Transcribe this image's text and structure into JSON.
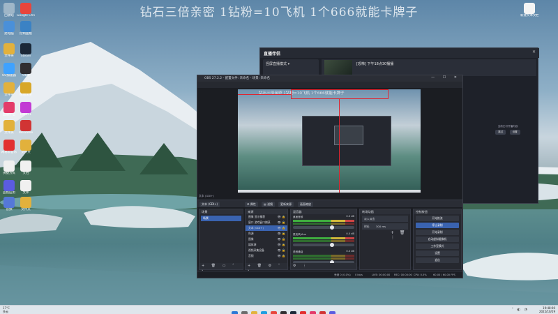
{
  "overlay_title": "钻石三倍亲密 1钻粉=10飞机  1个666就能卡牌子",
  "desktop_icons": [
    {
      "label": "回收站",
      "color": "#9fb6c8"
    },
    {
      "label": "Google Chrome",
      "color": "#e8453c"
    },
    {
      "label": "此电脑",
      "color": "#4a90d9"
    },
    {
      "label": "控制面板",
      "color": "#3b82c4"
    },
    {
      "label": "文件夹",
      "color": "#e2b13c"
    },
    {
      "label": "Steam",
      "color": "#1b2838"
    },
    {
      "label": "UU加速器",
      "color": "#3fa2ff"
    },
    {
      "label": "OBS",
      "color": "#302e31"
    },
    {
      "label": "文件夹",
      "color": "#e2b13c"
    },
    {
      "label": "绝地求生",
      "color": "#d8a728"
    },
    {
      "label": "直播伴侣",
      "color": "#e33b6a"
    },
    {
      "label": "Listen1",
      "color": "#c23bd4"
    },
    {
      "label": "文件夹",
      "color": "#e2b13c"
    },
    {
      "label": "WeGame",
      "color": "#d13434"
    },
    {
      "label": "网易云音乐",
      "color": "#e22f2f"
    },
    {
      "label": "文件夹",
      "color": "#e2b13c"
    },
    {
      "label": "快捷方式",
      "color": "#f0f0f0"
    },
    {
      "label": "文档",
      "color": "#f0f0f0"
    },
    {
      "label": "蓝色应用",
      "color": "#5b5ce0"
    },
    {
      "label": "文件",
      "color": "#f0f0f0"
    },
    {
      "label": "音频",
      "color": "#5578d8"
    },
    {
      "label": "文件夹",
      "color": "#e2b13c"
    },
    {
      "label": "新建文本文档",
      "color": "#f4f4f4"
    }
  ],
  "companion": {
    "logo": "直播伴侣",
    "mode": "竖屏直播模式 ▾",
    "live_title": "[恐怖] 下午18点30播播",
    "chips": [
      "游戏类别",
      "主播任务管理",
      "直播间"
    ],
    "right_info": "当前无可开播内容",
    "buttons": [
      "跳过",
      "设置"
    ]
  },
  "obs": {
    "title": "OBS 27.2.2 - 配置文件: 未命名 - 场景: 未命名",
    "window_controls": "— ☐ ✕",
    "menu": [
      "文件(F)",
      "编辑(E)",
      "视图(V)",
      "停靠窗口(D)",
      "配置文件(P)",
      "场景集合(S)",
      "工具(T)",
      "Streaming Center PLUG",
      "帮助(H)"
    ],
    "canvas_title": "钻石三倍亲密 1钻粉=10飞机  1个666就能卡牌子",
    "source_strip": [
      "文本 (GDI+)"
    ],
    "toolbar": {
      "settings": "属性",
      "filters": "滤镜",
      "sources_show": "文本 (GDI+)",
      "btn3": "更新来源",
      "btn4": "画面缩放"
    },
    "docks": {
      "scenes": {
        "title": "场景",
        "items": [
          "场景"
        ]
      },
      "sources": {
        "title": "来源",
        "items": [
          "图像 显示捕获",
          "窗口 游戏窗口捕获",
          "文本 (GDI+)",
          "色源",
          "图像",
          "媒体源",
          "视频采集设备",
          "音频"
        ]
      },
      "mixer": {
        "title": "混音器",
        "channels": [
          {
            "name": "桌面音频",
            "level": "0.0 dB"
          },
          {
            "name": "麦克风/Aux",
            "level": "0.0 dB"
          },
          {
            "name": "语音通话",
            "level": "0.0 dB"
          }
        ]
      },
      "transitions": {
        "title": "转场动画",
        "type": "淡入淡出",
        "duration_label": "时长",
        "duration": "300 ms"
      },
      "controls": {
        "title": "控制按钮",
        "buttons": [
          "开始推流",
          "停止录制",
          "开始录制",
          "启动虚拟摄像机",
          "工作室模式",
          "设置",
          "退出"
        ]
      }
    },
    "status": {
      "dropped": "丢帧 0 (0.0%)",
      "bitrate": "0 kb/s",
      "live": "LIVE: 00:00:00",
      "rec": "REC: 00:00:00",
      "cpu": "CPU: 0.5%",
      "fps": "60.00 / 60.00 FPS"
    }
  },
  "taskbar": {
    "weather": "17°C",
    "weather_desc": "多云",
    "time": "19:48:00",
    "date": "2022/10/29",
    "apps": [
      {
        "name": "start",
        "color": "#2b78d6"
      },
      {
        "name": "search",
        "color": "#6b6b6b"
      },
      {
        "name": "file-explorer",
        "color": "#e3b33c"
      },
      {
        "name": "edge",
        "color": "#1d9ee1"
      },
      {
        "name": "chrome",
        "color": "#e8453c"
      },
      {
        "name": "obs",
        "color": "#302e31"
      },
      {
        "name": "steam",
        "color": "#1b2838"
      },
      {
        "name": "netease",
        "color": "#e22f2f"
      },
      {
        "name": "companion",
        "color": "#e33b6a"
      },
      {
        "name": "wegame",
        "color": "#d13434"
      },
      {
        "name": "app",
        "color": "#5b5ce0"
      }
    ]
  }
}
